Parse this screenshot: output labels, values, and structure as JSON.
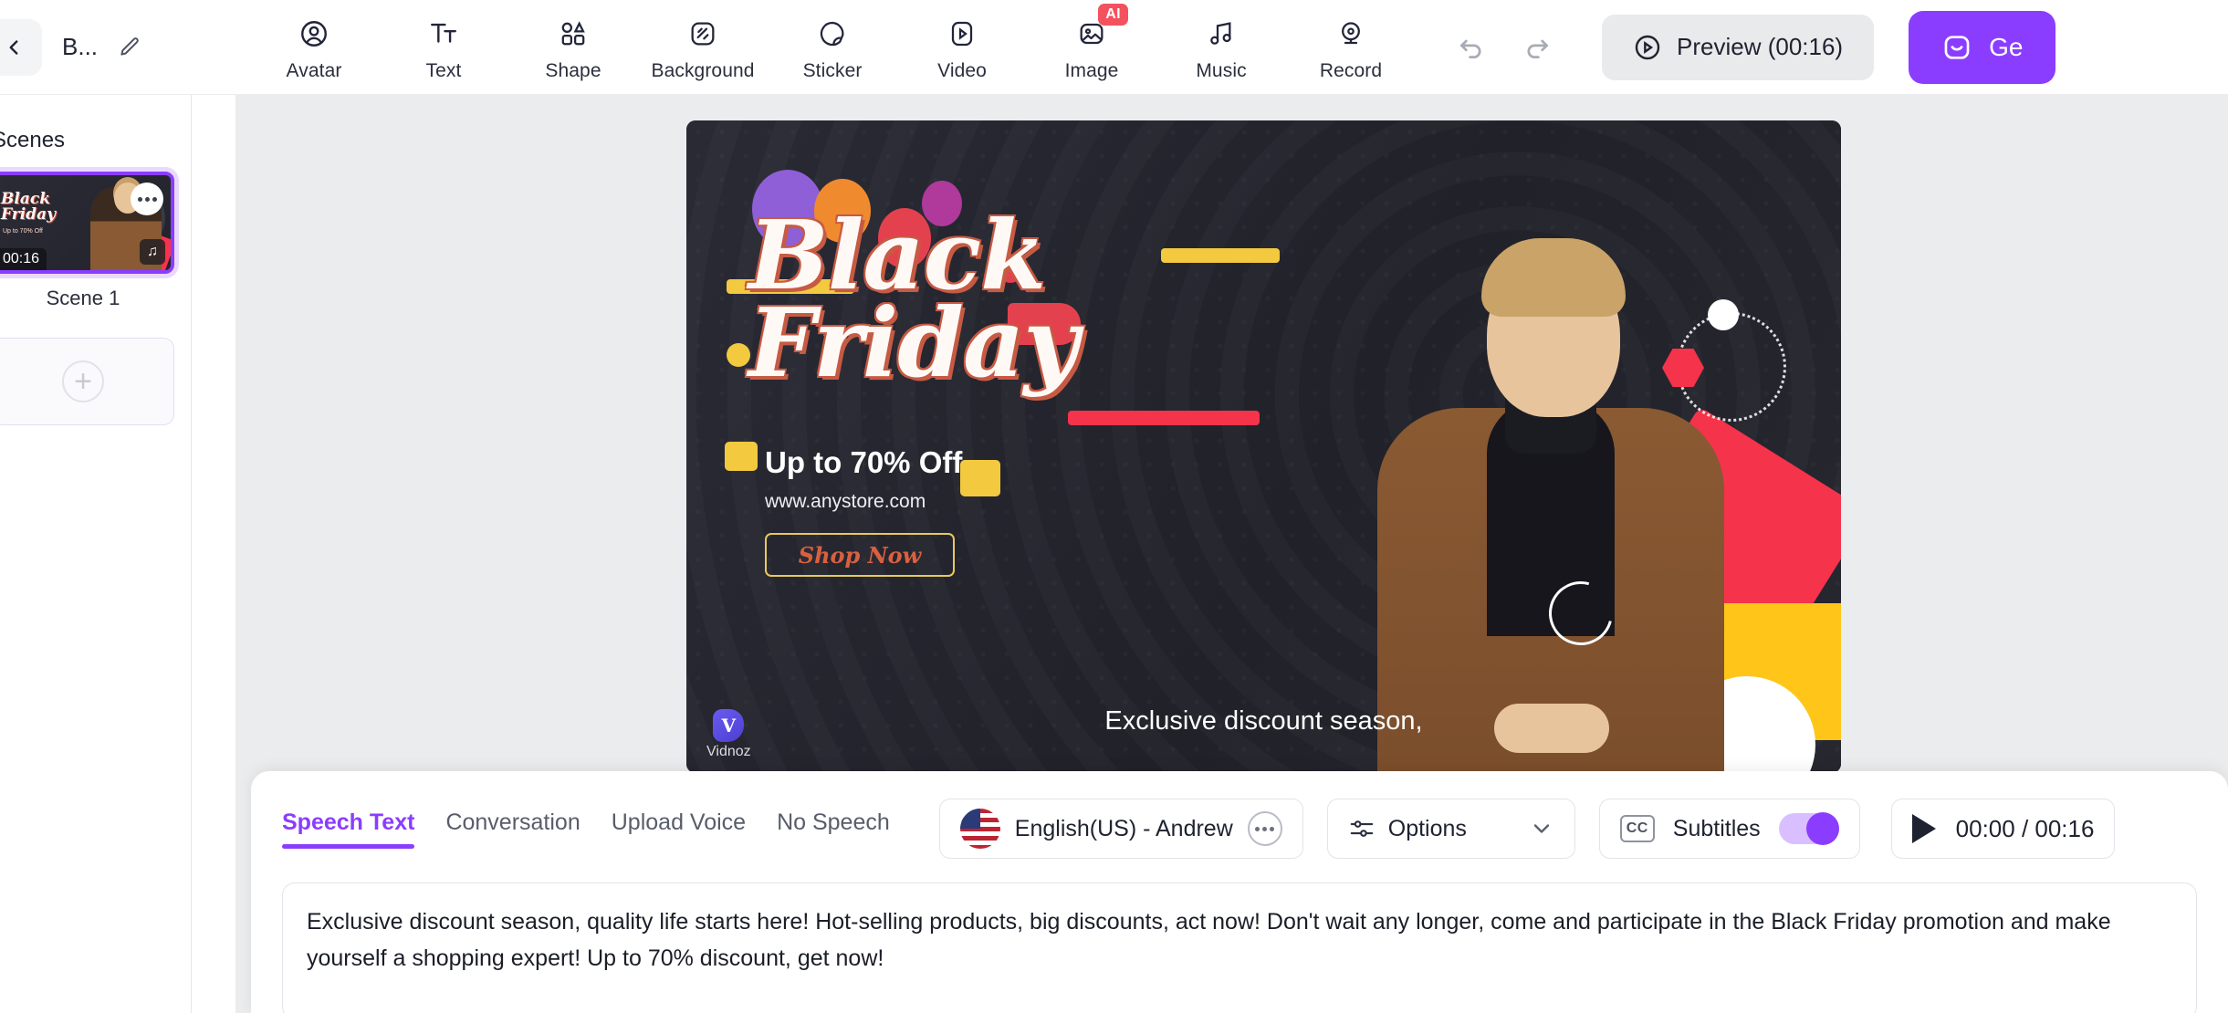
{
  "topbar": {
    "back_icon": "chevron-left-icon",
    "project_title": "B...",
    "edit_icon": "pencil-icon",
    "tools": [
      {
        "label": "Avatar",
        "icon": "avatar-icon"
      },
      {
        "label": "Text",
        "icon": "text-icon"
      },
      {
        "label": "Shape",
        "icon": "shape-icon"
      },
      {
        "label": "Background",
        "icon": "background-icon"
      },
      {
        "label": "Sticker",
        "icon": "sticker-icon"
      },
      {
        "label": "Video",
        "icon": "video-icon"
      },
      {
        "label": "Image",
        "icon": "image-icon",
        "badge": "AI"
      },
      {
        "label": "Music",
        "icon": "music-icon"
      },
      {
        "label": "Record",
        "icon": "record-icon"
      }
    ],
    "undo_icon": "undo-icon",
    "redo_icon": "redo-icon",
    "preview_label": "Preview (00:16)",
    "preview_icon": "play-circle-icon",
    "generate_label": "Ge",
    "generate_icon": "generate-icon",
    "accent_purple": "#8b3dff",
    "badge_red": "#f4515e"
  },
  "sidebar": {
    "title": "Scenes",
    "scenes": [
      {
        "label": "Scene 1",
        "duration": "00:16",
        "thumb_title": "Black Friday",
        "thumb_sub": "Up to 70% Off",
        "menu_icon": "more-options-icon",
        "music_icon": "music-note-icon"
      }
    ],
    "add_scene_icon": "plus-icon"
  },
  "canvas": {
    "title_line1": "Black",
    "title_line2": "Friday",
    "discount": "Up to 70% Off",
    "url": "www.anystore.com",
    "cta": "Shop Now",
    "subtitle": "Exclusive discount season,",
    "watermark": "Vidnoz",
    "watermark_mark": "V",
    "collapse_icon": "chevron-down-icon"
  },
  "bottom": {
    "tabs": [
      {
        "label": "Speech Text",
        "active": true
      },
      {
        "label": "Conversation",
        "active": false
      },
      {
        "label": "Upload Voice",
        "active": false
      },
      {
        "label": "No Speech",
        "active": false
      }
    ],
    "voice": {
      "flag_icon": "us-flag-icon",
      "name": "English(US) - Andrew",
      "more_icon": "more-options-icon"
    },
    "options": {
      "label": "Options",
      "icon": "sliders-icon",
      "chevron": "chevron-down-icon"
    },
    "subtitles": {
      "label": "Subtitles",
      "icon": "cc-icon",
      "icon_text": "CC",
      "enabled": true
    },
    "player": {
      "play_icon": "play-icon",
      "time": "00:00 / 00:16"
    },
    "script": "Exclusive discount season, quality life starts here! Hot-selling products, big discounts, act now! Don't wait any longer, come and participate in the Black Friday promotion and make yourself a shopping expert! Up to 70% discount, get now!"
  }
}
